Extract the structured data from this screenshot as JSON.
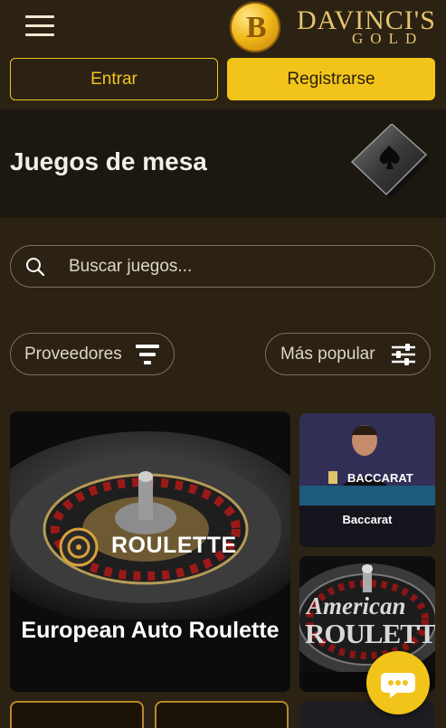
{
  "header": {
    "menu_icon": "hamburger-icon",
    "logo": {
      "word1": "DAVINCI'S",
      "word2": "GOLD",
      "coin_letter": "B"
    },
    "login_label": "Entrar",
    "register_label": "Registrarse"
  },
  "banner": {
    "title": "Juegos de mesa",
    "icon": "ace-of-spades-card-icon"
  },
  "search": {
    "placeholder": "Buscar juegos..."
  },
  "filters": {
    "providers_label": "Proveedores",
    "sort_label": "Más popular"
  },
  "games": [
    {
      "title": "European Auto Roulette",
      "badge": "ROULETTE"
    },
    {
      "title": "Baccarat",
      "badge": "BACCARAT"
    },
    {
      "title": "American Roulette",
      "badge_word1": "American",
      "badge_word2": "ROULETTE"
    }
  ],
  "colors": {
    "background": "#2b2214",
    "accent": "#f2c41a",
    "banner": "#1d180f"
  },
  "chat": {
    "icon": "chat-bubble-icon"
  }
}
